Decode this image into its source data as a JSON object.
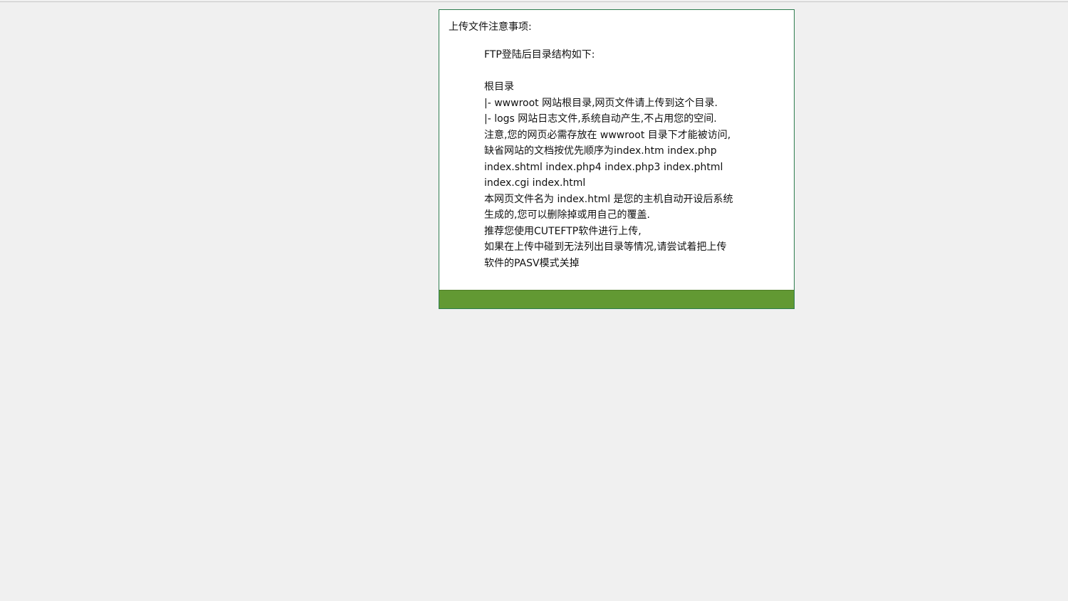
{
  "notice": {
    "title": "上传文件注意事项:",
    "lines": [
      "FTP登陆后目录结构如下:",
      "",
      "根目录",
      "|- wwwroot 网站根目录,网页文件请上传到这个目录.",
      "|- logs 网站日志文件,系统自动产生,不占用您的空间.",
      "注意,您的网页必需存放在 wwwroot 目录下才能被访问,",
      "缺省网站的文档按优先顺序为index.htm index.php",
      "index.shtml index.php4 index.php3 index.phtml",
      "index.cgi index.html",
      "本网页文件名为 index.html 是您的主机自动开设后系统",
      "生成的,您可以删除掉或用自己的覆盖.",
      "推荐您使用CUTEFTP软件进行上传,",
      "如果在上传中碰到无法列出目录等情况,请尝试着把上传",
      "软件的PASV模式关掉"
    ]
  },
  "colors": {
    "page_background": "#f0f0f0",
    "box_border": "#2e7d4f",
    "footer_bar": "#629933"
  }
}
